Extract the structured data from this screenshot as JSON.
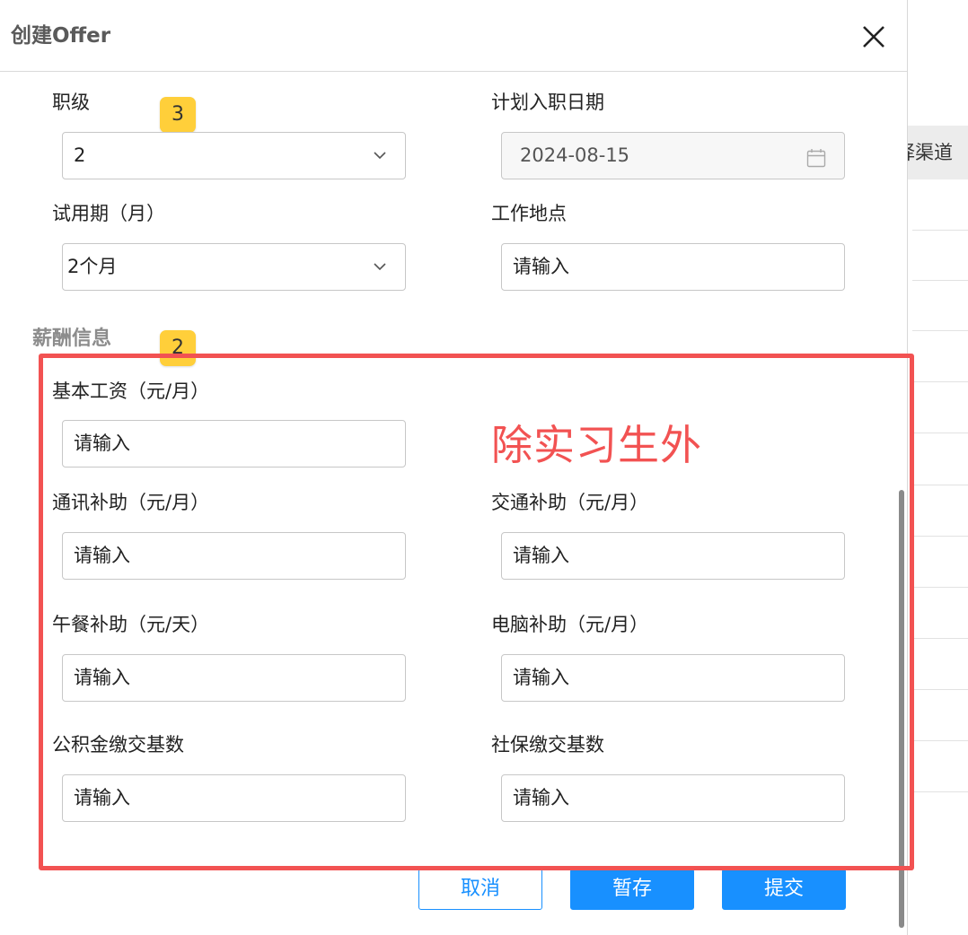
{
  "dialog": {
    "title": "创建Offer"
  },
  "background": {
    "tab_label": "择渠道"
  },
  "form": {
    "level": {
      "label": "职级",
      "value": "2"
    },
    "start_date": {
      "label": "计划入职日期",
      "value": "2024-08-15"
    },
    "probation": {
      "label": "试用期（月）",
      "value": "2个月"
    },
    "work_location": {
      "label": "工作地点",
      "placeholder": "请输入"
    }
  },
  "salary": {
    "section_title": "薪酬信息",
    "base_salary": {
      "label": "基本工资（元/月）",
      "placeholder": "请输入"
    },
    "comm_allowance": {
      "label": "通讯补助（元/月）",
      "placeholder": "请输入"
    },
    "transport_allowance": {
      "label": "交通补助（元/月）",
      "placeholder": "请输入"
    },
    "lunch_allowance": {
      "label": "午餐补助（元/天）",
      "placeholder": "请输入"
    },
    "computer_allowance": {
      "label": "电脑补助（元/月）",
      "placeholder": "请输入"
    },
    "housing_fund_base": {
      "label": "公积金缴交基数",
      "placeholder": "请输入"
    },
    "social_insurance_base": {
      "label": "社保缴交基数",
      "placeholder": "请输入"
    }
  },
  "annotations": {
    "badge_top": "3",
    "badge_section": "2",
    "note": "除实习生外",
    "highlight_color": "#f25252",
    "badge_color": "#ffcf3a"
  },
  "buttons": {
    "cancel": "取消",
    "save": "暂存",
    "submit": "提交"
  },
  "colors": {
    "primary": "#1890ff"
  }
}
